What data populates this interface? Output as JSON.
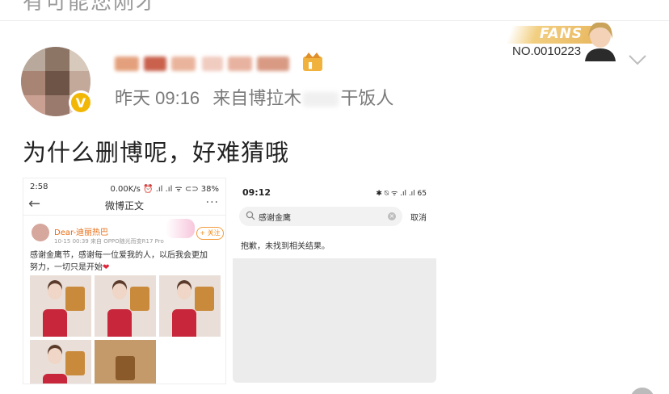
{
  "prev_post": {
    "partial_text": "有可能您刚才"
  },
  "post": {
    "author": {
      "avatar": "avatar",
      "verified_icon": "verified-badge-icon"
    },
    "timestamp": "昨天 09:16",
    "source_prefix": "来自博拉木",
    "source_suffix": "干饭人",
    "text": "为什么删博呢，好难猜哦",
    "fans_badge": {
      "label": "FANS",
      "number": "NO.0010223"
    }
  },
  "screenshot_left": {
    "status_time": "2:58",
    "status_right": "0.00K/s ⏰ .ıl .ıl ᯤ ⊂⊃ 38%",
    "nav_title": "微博正文",
    "back_icon": "back-arrow-icon",
    "more_icon": "more-icon",
    "username": "Dear-迪丽热巴",
    "time_source": "10-15 00:39  来自 OPPO随光而变R17 Pro",
    "follow": "+ 关注",
    "body_line1": "感谢金鹰节，感谢每一位爱我的人，以后我会更加",
    "body_line2": "努力，一切只是开始",
    "heart": "❤"
  },
  "screenshot_right": {
    "status_time": "09:12",
    "status_right": "✱ ⍉ ᯤ .ıl .ıl 65",
    "search_query": "感谢金鹰",
    "clear_icon": "×",
    "cancel": "取消",
    "no_result": "抱歉，未找到相关结果。"
  },
  "colors": {
    "accent": "#f39c3c",
    "username": "#e86b12",
    "verified": "#f2b705"
  }
}
